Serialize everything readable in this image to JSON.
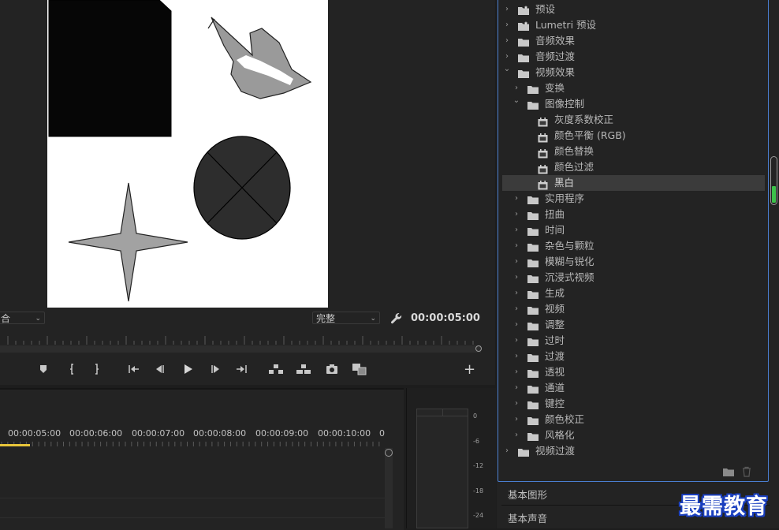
{
  "monitor": {
    "fit_value": "合",
    "quality_value": "完整",
    "timecode": "00:00:05:00",
    "add_label": "+"
  },
  "timeline": {
    "timecodes": [
      "00:00:05:00",
      "00:00:06:00",
      "00:00:07:00",
      "00:00:08:00",
      "00:00:09:00",
      "00:00:10:00",
      "0"
    ]
  },
  "meter": {
    "db_labels": [
      "0",
      "-6",
      "-12",
      "-18",
      "-24"
    ]
  },
  "effects": {
    "tree": [
      {
        "label": "预设",
        "type": "bin-special",
        "level": 0,
        "expanded": false
      },
      {
        "label": "Lumetri 预设",
        "type": "bin-special",
        "level": 0,
        "expanded": false
      },
      {
        "label": "音频效果",
        "type": "bin",
        "level": 0,
        "expanded": false
      },
      {
        "label": "音频过渡",
        "type": "bin",
        "level": 0,
        "expanded": false
      },
      {
        "label": "视频效果",
        "type": "bin",
        "level": 0,
        "expanded": true
      },
      {
        "label": "变换",
        "type": "bin",
        "level": 1,
        "expanded": false
      },
      {
        "label": "图像控制",
        "type": "bin",
        "level": 1,
        "expanded": true
      },
      {
        "label": "灰度系数校正",
        "type": "effect",
        "level": 2
      },
      {
        "label": "颜色平衡 (RGB)",
        "type": "effect",
        "level": 2
      },
      {
        "label": "颜色替换",
        "type": "effect",
        "level": 2
      },
      {
        "label": "颜色过滤",
        "type": "effect",
        "level": 2
      },
      {
        "label": "黑白",
        "type": "effect",
        "level": 2,
        "selected": true
      },
      {
        "label": "实用程序",
        "type": "bin",
        "level": 1,
        "expanded": false
      },
      {
        "label": "扭曲",
        "type": "bin",
        "level": 1,
        "expanded": false
      },
      {
        "label": "时间",
        "type": "bin",
        "level": 1,
        "expanded": false
      },
      {
        "label": "杂色与颗粒",
        "type": "bin",
        "level": 1,
        "expanded": false
      },
      {
        "label": "模糊与锐化",
        "type": "bin",
        "level": 1,
        "expanded": false
      },
      {
        "label": "沉浸式视频",
        "type": "bin",
        "level": 1,
        "expanded": false
      },
      {
        "label": "生成",
        "type": "bin",
        "level": 1,
        "expanded": false
      },
      {
        "label": "视频",
        "type": "bin",
        "level": 1,
        "expanded": false
      },
      {
        "label": "调整",
        "type": "bin",
        "level": 1,
        "expanded": false
      },
      {
        "label": "过时",
        "type": "bin",
        "level": 1,
        "expanded": false
      },
      {
        "label": "过渡",
        "type": "bin",
        "level": 1,
        "expanded": false
      },
      {
        "label": "透视",
        "type": "bin",
        "level": 1,
        "expanded": false
      },
      {
        "label": "通道",
        "type": "bin",
        "level": 1,
        "expanded": false
      },
      {
        "label": "键控",
        "type": "bin",
        "level": 1,
        "expanded": false
      },
      {
        "label": "颜色校正",
        "type": "bin",
        "level": 1,
        "expanded": false
      },
      {
        "label": "风格化",
        "type": "bin",
        "level": 1,
        "expanded": false
      },
      {
        "label": "视频过渡",
        "type": "bin",
        "level": 0,
        "expanded": false
      }
    ],
    "new_bin_icon": "folder-icon",
    "delete_icon": "trash-icon"
  },
  "panels": {
    "essential_graphics": "基本图形",
    "essential_sound": "基本声音"
  },
  "watermark": "最需教育",
  "colors": {
    "accent_border": "#4a7ed0",
    "playhead": "#e8c53a",
    "meter_green": "#3cc24a"
  }
}
